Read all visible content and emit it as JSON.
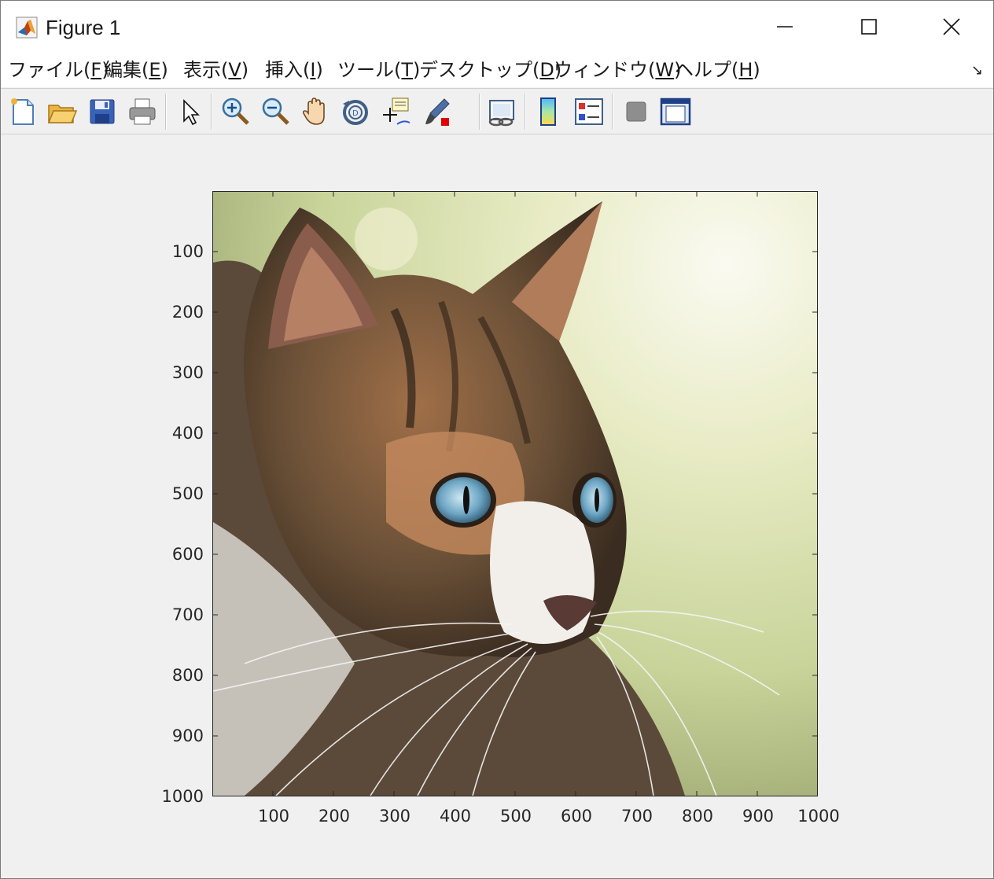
{
  "window": {
    "title": "Figure 1",
    "icon": "matlab-icon"
  },
  "menu": [
    {
      "label": "ファイル(",
      "key": "F",
      "suffix": ")"
    },
    {
      "label": "編集(",
      "key": "E",
      "suffix": ")"
    },
    {
      "label": "表示(",
      "key": "V",
      "suffix": ")"
    },
    {
      "label": "挿入(",
      "key": "I",
      "suffix": ")"
    },
    {
      "label": "ツール(",
      "key": "T",
      "suffix": ")"
    },
    {
      "label": "デスクトップ(",
      "key": "D",
      "suffix": ")"
    },
    {
      "label": "ウィンドウ(",
      "key": "W",
      "suffix": ")"
    },
    {
      "label": "ヘルプ(",
      "key": "H",
      "suffix": ")"
    }
  ],
  "toolbar": [
    "new-figure-icon",
    "open-file-icon",
    "save-icon",
    "print-icon",
    "select-arrow-icon",
    "zoom-in-icon",
    "zoom-out-icon",
    "pan-hand-icon",
    "rotate-3d-icon",
    "data-cursor-icon",
    "brush-icon",
    "link-plot-icon",
    "colorbar-icon",
    "legend-icon",
    "hide-plot-tools-icon",
    "show-plot-tools-icon"
  ],
  "axes": {
    "image": "cat-photo",
    "xlim": [
      0,
      1000
    ],
    "ylim": [
      0,
      1000
    ],
    "y_direction": "reverse",
    "x_ticks": [
      "100",
      "200",
      "300",
      "400",
      "500",
      "600",
      "700",
      "800",
      "900",
      "1000"
    ],
    "y_ticks": [
      "100",
      "200",
      "300",
      "400",
      "500",
      "600",
      "700",
      "800",
      "900",
      "1000"
    ]
  }
}
